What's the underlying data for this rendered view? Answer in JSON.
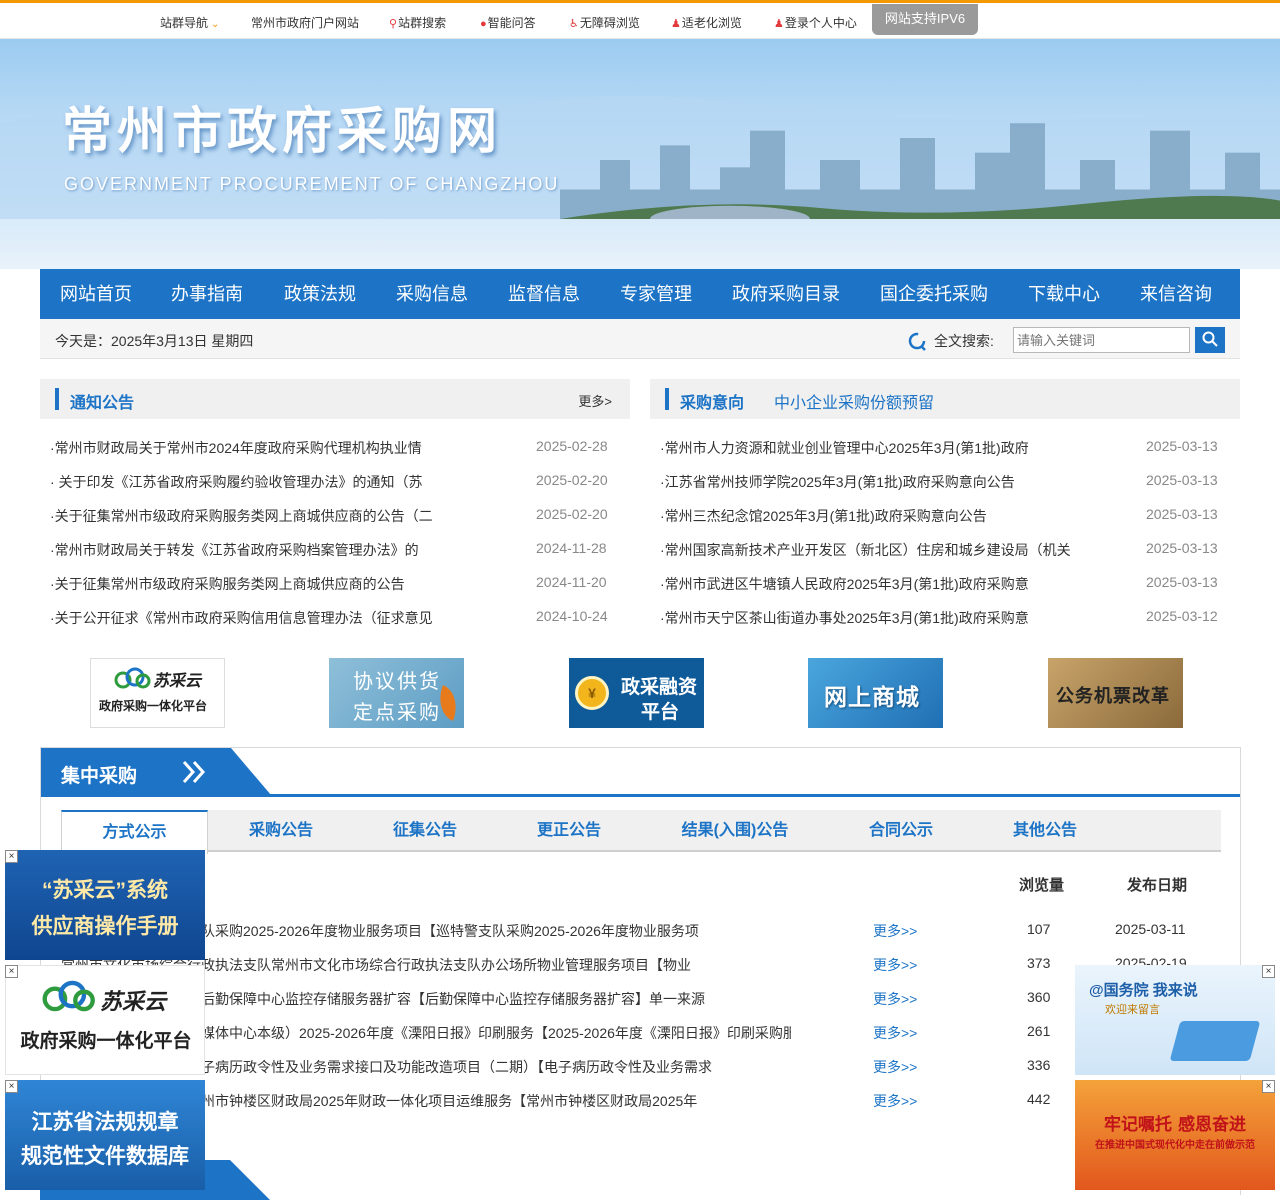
{
  "topbar": {
    "items": [
      {
        "label": "站群导航",
        "icon": "chevron-down-icon"
      },
      {
        "label": "常州市政府门户网站"
      },
      {
        "label": "站群搜索",
        "icon": "search-icon"
      },
      {
        "label": "智能问答",
        "icon": "chat-icon"
      },
      {
        "label": "无障碍浏览",
        "icon": "accessibility-icon"
      },
      {
        "label": "适老化浏览",
        "icon": "elderly-icon"
      },
      {
        "label": "登录个人中心",
        "icon": "user-icon"
      }
    ],
    "ipv6": "网站支持IPV6"
  },
  "banner": {
    "title": "常州市政府采购网",
    "subtitle": "GOVERNMENT PROCUREMENT OF CHANGZHOU"
  },
  "nav": [
    "网站首页",
    "办事指南",
    "政策法规",
    "采购信息",
    "监督信息",
    "专家管理",
    "政府采购目录",
    "国企委托采购",
    "下载中心",
    "来信咨询"
  ],
  "infobar": {
    "today": "今天是：2025年3月13日 星期四",
    "search_label": "全文搜索:",
    "search_placeholder": "请输入关键词"
  },
  "notices": {
    "title": "通知公告",
    "more": "更多>",
    "items": [
      {
        "title": "·常州市财政局关于常州市2024年度政府采购代理机构执业情",
        "date": "2025-02-28"
      },
      {
        "title": "· 关于印发《江苏省政府采购履约验收管理办法》的通知（苏",
        "date": "2025-02-20"
      },
      {
        "title": "·关于征集常州市级政府采购服务类网上商城供应商的公告（二",
        "date": "2025-02-20"
      },
      {
        "title": "·常州市财政局关于转发《江苏省政府采购档案管理办法》的",
        "date": "2024-11-28"
      },
      {
        "title": "·关于征集常州市级政府采购服务类网上商城供应商的公告",
        "date": "2024-11-20"
      },
      {
        "title": "·关于公开征求《常州市政府采购信用信息管理办法（征求意见",
        "date": "2024-10-24"
      }
    ]
  },
  "intentions": {
    "title": "采购意向",
    "subtitle": "中小企业采购份额预留",
    "items": [
      {
        "title": "·常州市人力资源和就业创业管理中心2025年3月(第1批)政府",
        "date": "2025-03-13"
      },
      {
        "title": "·江苏省常州技师学院2025年3月(第1批)政府采购意向公告",
        "date": "2025-03-13"
      },
      {
        "title": "·常州三杰纪念馆2025年3月(第1批)政府采购意向公告",
        "date": "2025-03-13"
      },
      {
        "title": "·常州国家高新技术产业开发区（新北区）住房和城乡建设局（机关",
        "date": "2025-03-13"
      },
      {
        "title": "·常州市武进区牛塘镇人民政府2025年3月(第1批)政府采购意",
        "date": "2025-03-13"
      },
      {
        "title": "·常州市天宁区茶山街道办事处2025年3月(第1批)政府采购意",
        "date": "2025-03-12"
      }
    ]
  },
  "logos": [
    {
      "line1": "苏采云",
      "line2": "政府采购一体化平台"
    },
    {
      "line1": "协议供货",
      "line2": "定点采购"
    },
    {
      "line1": "政采融资",
      "line2": "平台"
    },
    {
      "line1": "网上商城",
      "line2": ""
    },
    {
      "line1": "公务机票改革",
      "line2": ""
    }
  ],
  "centralized": {
    "title": "集中采购",
    "tabs": [
      "方式公示",
      "采购公告",
      "征集公告",
      "更正公告",
      "结果(入围)公告",
      "合同公示",
      "其他公告"
    ],
    "col_views": "浏览量",
    "col_date": "发布日期",
    "rows": [
      {
        "title": "常州市公安局巡特警支队采购2025-2026年度物业服务项目【巡特警支队采购2025-2026年度物业服务项",
        "more": "更多>>",
        "views": "107",
        "date": "2025-03-11"
      },
      {
        "title": "常州市文化市场综合行政执法支队常州市文化市场综合行政执法支队办公场所物业管理服务项目【物业",
        "more": "更多>>",
        "views": "373",
        "date": "2025-02-19"
      },
      {
        "title": "常州市机关事务管理局后勤保障中心监控存储服务器扩容【后勤保障中心监控存储服务器扩容】单一来源",
        "more": "更多>>",
        "views": "360",
        "date": ""
      },
      {
        "title": "溧阳日报社（溧阳市融媒体中心本级）2025-2026年度《溧阳日报》印刷服务【2025-2026年度《溧阳日报》印刷采购服",
        "more": "更多>>",
        "views": "261",
        "date": ""
      },
      {
        "title": "常州市第一人民医院电子病历政令性及业务需求接口及功能改造项目（二期）【电子病历政令性及业务需求",
        "more": "更多>>",
        "views": "336",
        "date": ""
      },
      {
        "title": "常州市钟楼区财政局常州市钟楼区财政局2025年财政一体化项目运维服务【常州市钟楼区财政局2025年",
        "more": "更多>>",
        "views": "442",
        "date": ""
      }
    ]
  },
  "float_left": [
    {
      "line1": "“苏采云”系统",
      "line2": "供应商操作手册"
    },
    {
      "line1": "苏采云",
      "line2": "政府采购一体化平台"
    },
    {
      "line1": "江苏省法规规章",
      "line2": "规范性文件数据库"
    }
  ],
  "float_right": [
    {
      "line1": "@国务院 我来说",
      "line2": "欢迎来留言"
    },
    {
      "line1": "牢记嘱托 感恩奋进",
      "line2": "在推进中国式现代化中走在前做示范"
    }
  ],
  "close_label": "×"
}
